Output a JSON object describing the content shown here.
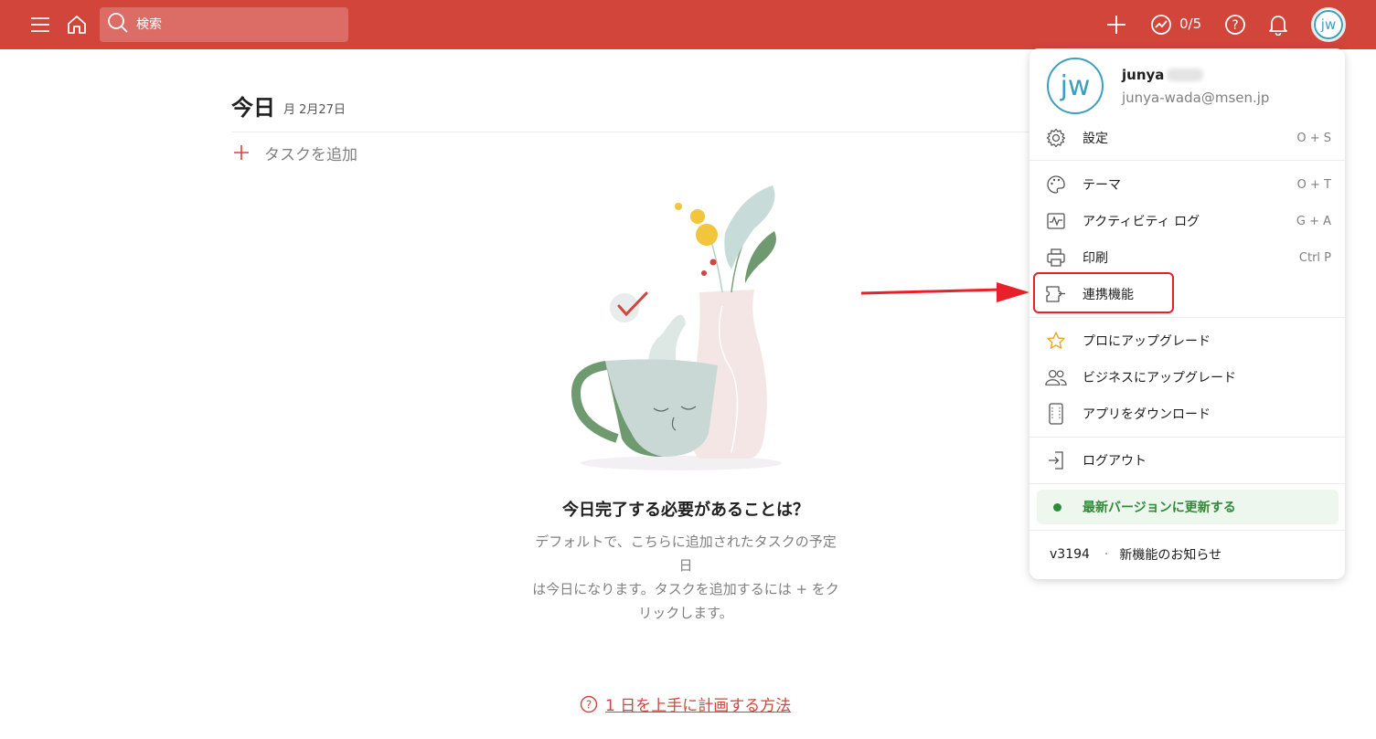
{
  "topbar": {
    "search_placeholder": "検索",
    "karma": "0/5"
  },
  "user": {
    "initials": "jw",
    "name": "junya",
    "email": "junya-wada@msen.jp"
  },
  "view": {
    "title": "今日",
    "date": "月 2月27日",
    "add_task_label": "タスクを追加"
  },
  "empty_state": {
    "title": "今日完了する必要があることは？",
    "desc_line1": "デフォルトで、こちらに追加されたタスクの予定日",
    "desc_line2": "は今日になります。タスクを追加するには + をク",
    "desc_line3": "リックします。"
  },
  "help_link": "1 日を上手に計画する方法",
  "menu": {
    "settings": {
      "label": "設定",
      "shortcut": "O + S"
    },
    "theme": {
      "label": "テーマ",
      "shortcut": "O + T"
    },
    "activity": {
      "label": "アクティビティ ログ",
      "shortcut": "G + A"
    },
    "print": {
      "label": "印刷",
      "shortcut": "Ctrl P"
    },
    "integrations": {
      "label": "連携機能"
    },
    "upgrade_pro": {
      "label": "プロにアップグレード"
    },
    "upgrade_business": {
      "label": "ビジネスにアップグレード"
    },
    "download": {
      "label": "アプリをダウンロード"
    },
    "logout": {
      "label": "ログアウト"
    },
    "update": {
      "label": "最新バージョンに更新する"
    },
    "version": "v3194",
    "version_sep": "·",
    "whats_new": "新機能のお知らせ"
  },
  "colors": {
    "brand": "#d1453b",
    "avatar": "#3d9fbf",
    "update_green": "#2e8b3a",
    "highlight": "#e8202a"
  },
  "icons": [
    "menu-icon",
    "home-icon",
    "search-icon",
    "plus-icon",
    "karma-icon",
    "help-icon",
    "bell-icon",
    "gear-icon",
    "palette-icon",
    "activity-icon",
    "printer-icon",
    "puzzle-icon",
    "star-icon",
    "users-icon",
    "device-icon",
    "logout-icon"
  ]
}
